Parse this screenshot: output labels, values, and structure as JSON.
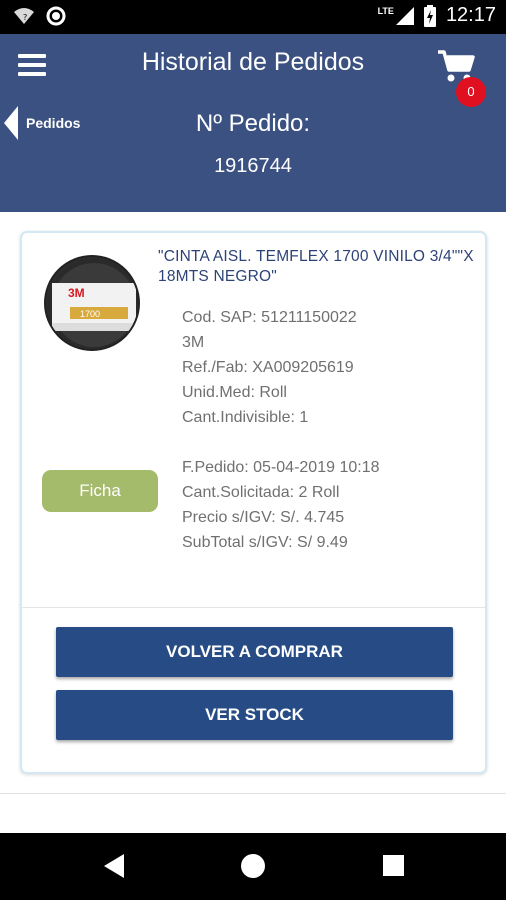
{
  "status_bar": {
    "time": "12:17",
    "network": "LTE",
    "icons": [
      "wifi-unknown-icon",
      "circle-notification-icon",
      "signal-icon",
      "battery-charging-icon"
    ]
  },
  "header": {
    "title": "Historial de Pedidos",
    "cart_count": "0",
    "back_label": "Pedidos",
    "order_label": "Nº Pedido:",
    "order_number": "1916744"
  },
  "product": {
    "name": "\"CINTA AISL. TEMFLEX 1700 VINILO 3/4\"\"X 18MTS NEGRO\"",
    "image_brand": "3M",
    "image_model": "1700",
    "details": {
      "cod_sap": "Cod. SAP: 51211150022",
      "brand": "3M",
      "ref_fab": "Ref./Fab: XA009205619",
      "unid_med": "Unid.Med: Roll",
      "cant_indivisible": "Cant.Indivisible: 1"
    },
    "order_info": {
      "fecha": "F.Pedido: 05-04-2019 10:18",
      "cantidad": "Cant.Solicitada: 2 Roll",
      "precio": "Precio s/IGV: S/. 4.745",
      "subtotal": "SubTotal s/IGV: S/ 9.49"
    },
    "ficha_label": "Ficha"
  },
  "actions": {
    "buy_again": "VOLVER A COMPRAR",
    "view_stock": "VER STOCK"
  },
  "colors": {
    "header_bg": "#3b5181",
    "button_bg": "#274c85",
    "ficha_bg": "#a3bb6b",
    "badge_bg": "#e01020",
    "product_name": "#2d4377"
  }
}
